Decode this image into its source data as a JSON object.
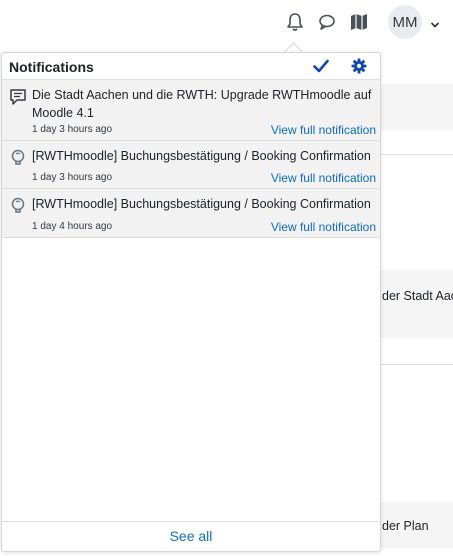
{
  "navbar": {
    "icons": [
      "bell-icon",
      "chat-icon",
      "map-icon",
      "chevron-down-icon"
    ],
    "avatar_initials": "MM"
  },
  "background": {
    "text1": "der Stadt Aach",
    "text2": "der Plan"
  },
  "notifications": {
    "title": "Notifications",
    "mark_read_icon": "check-icon",
    "settings_icon": "gear-icon",
    "items": [
      {
        "icon": "comment-icon",
        "text": "Die Stadt Aachen und die RWTH: Upgrade RWTHmoodle auf Moodle 4.1",
        "time": "1 day 3 hours ago",
        "link": "View full notification"
      },
      {
        "icon": "bulb-icon",
        "text": "[RWTHmoodle] Buchungsbestätigung / Booking Confirmation",
        "time": "1 day 3 hours ago",
        "link": "View full notification"
      },
      {
        "icon": "bulb-icon",
        "text": "[RWTHmoodle] Buchungsbestätigung / Booking Confirmation",
        "time": "1 day 4 hours ago",
        "link": "View full notification"
      }
    ],
    "see_all": "See all"
  },
  "colors": {
    "link": "#0f6cbf",
    "item_bg": "#f2f2f2",
    "accent_icon": "#0f47ad"
  }
}
